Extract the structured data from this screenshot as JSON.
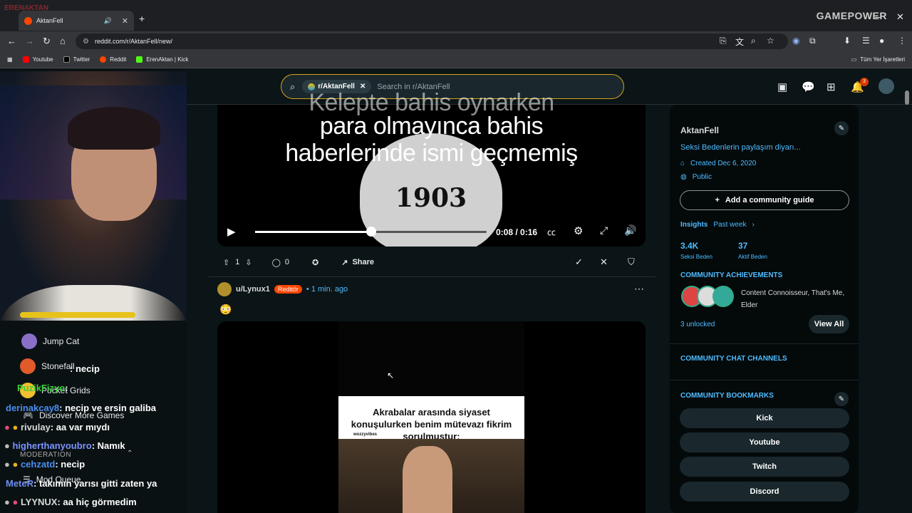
{
  "browser": {
    "tab_title": "AktanFell",
    "url": "reddit.com/r/AktanFell/new/",
    "watermark_left": "ERENAKTAN",
    "watermark_right": "GAMEPOWER",
    "bookmarks": [
      "Youtube",
      "Twitter",
      "Reddit",
      "ErenAktan | Kick"
    ],
    "bookmarks_right": "Tüm Yer İşaretleri"
  },
  "header": {
    "community_chip": "r/AktanFell",
    "search_placeholder": "Search in r/AktanFell",
    "notification_count": "3"
  },
  "overlay": {
    "menu": [
      "Jump Cat",
      "Stonefall",
      "Pocket Grids",
      "Discover More Games"
    ],
    "moderation_label": "MODERATION",
    "mod_queue": "Mod Queue",
    "chat": [
      {
        "user": "",
        "msg": ": necip"
      },
      {
        "user": "PuzikFizyo",
        "msg": ":"
      },
      {
        "user": "derinakcay8",
        "msg": ": necip ve ersin galiba"
      },
      {
        "user": "rivulay",
        "msg": ": aa var mıydı"
      },
      {
        "user": "higherthanyoubro",
        "msg": ": Namık"
      },
      {
        "user": "cehzatd",
        "msg": ": necip"
      },
      {
        "user": "MeteR",
        "msg": ": takımın yarısı gitti zaten ya"
      },
      {
        "user": "LYYNUX",
        "msg": ": aa hiç görmedim"
      }
    ]
  },
  "post1": {
    "caption_lines": [
      "Kelepte bahis oynarken",
      "para olmayınca bahis",
      "haberlerinde ismi geçmemiş"
    ],
    "logo_text": "1903",
    "time": "0:08 / 0:16",
    "progress": 0.5,
    "votes": "1",
    "comments": "0",
    "share": "Share"
  },
  "post2": {
    "user": "u/Lynux1",
    "flair": "Reditör",
    "age": "• 1 min. ago",
    "emoji": "😳",
    "meme_text": "Akrabalar arasında siyaset konuşulurken benim mütevazı fikrim sorulmuştur:",
    "meme_credit": "wozzyvibes"
  },
  "sidebar": {
    "name": "AktanFell",
    "description": "Seksi Bedenlerin paylaşım diyarı...",
    "created": "Created Dec 6, 2020",
    "visibility": "Public",
    "add_guide": "Add a community guide",
    "insights": "Insights",
    "insights_range": "Past week",
    "members_count": "3.4K",
    "members_label": "Seksi Beden",
    "active_count": "37",
    "active_label": "Aktif Beden",
    "achievements_title": "COMMUNITY ACHIEVEMENTS",
    "achievements_text": "Content Connoisseur, That's Me, Elder",
    "unlocked": "3 unlocked",
    "view_all": "View All",
    "chat_title": "COMMUNITY CHAT CHANNELS",
    "bookmarks_title": "COMMUNITY BOOKMARKS",
    "bookmark_links": [
      "Kick",
      "Youtube",
      "Twitch",
      "Discord"
    ]
  }
}
